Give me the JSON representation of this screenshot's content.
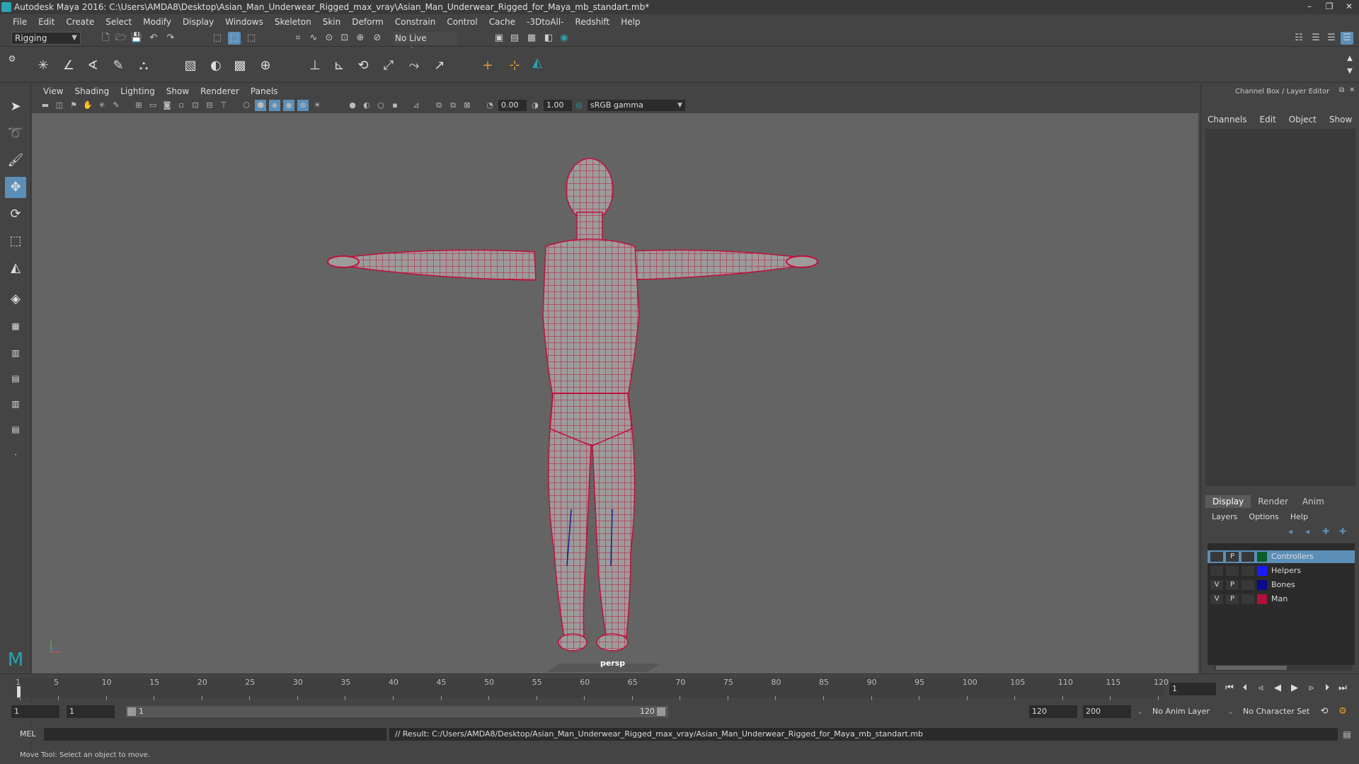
{
  "window": {
    "title": "Autodesk Maya 2016: C:\\Users\\AMDA8\\Desktop\\Asian_Man_Underwear_Rigged_max_vray\\Asian_Man_Underwear_Rigged_for_Maya_mb_standart.mb*"
  },
  "menubar": [
    "File",
    "Edit",
    "Create",
    "Select",
    "Modify",
    "Display",
    "Windows",
    "Skeleton",
    "Skin",
    "Deform",
    "Constrain",
    "Control",
    "Cache",
    "-3DtoAll-",
    "Redshift",
    "Help"
  ],
  "status": {
    "mode": "Rigging",
    "live_surface": "No Live Surface"
  },
  "panel": {
    "menu": [
      "View",
      "Shading",
      "Lighting",
      "Show",
      "Renderer",
      "Panels"
    ],
    "near_value": "0.00",
    "far_value": "1.00",
    "color_space": "sRGB gamma",
    "camera_label": "persp"
  },
  "channel_box": {
    "title": "Channel Box / Layer Editor",
    "menu": [
      "Channels",
      "Edit",
      "Object",
      "Show"
    ]
  },
  "layer_editor": {
    "tabs": [
      "Display",
      "Render",
      "Anim"
    ],
    "selected_tab": "Display",
    "menu": [
      "Layers",
      "Options",
      "Help"
    ],
    "layers": [
      {
        "name": "Controllers",
        "v": "",
        "p": "P",
        "color": "#0b5e2a",
        "selected": true
      },
      {
        "name": "Helpers",
        "v": "",
        "p": "",
        "color": "#1a1aff",
        "selected": false
      },
      {
        "name": "Bones",
        "v": "V",
        "p": "P",
        "color": "#0a0a8a",
        "selected": false
      },
      {
        "name": "Man",
        "v": "V",
        "p": "P",
        "color": "#b0103a",
        "selected": false
      }
    ]
  },
  "timeline": {
    "tick_labels": [
      "1",
      "5",
      "10",
      "15",
      "20",
      "25",
      "30",
      "35",
      "40",
      "45",
      "50",
      "55",
      "60",
      "65",
      "70",
      "75",
      "80",
      "85",
      "90",
      "95",
      "100",
      "105",
      "110",
      "115",
      "120"
    ],
    "current_frame": "1"
  },
  "range": {
    "start": "1",
    "playback_start": "1",
    "slider_start": "1",
    "slider_end": "120",
    "playback_end": "120",
    "end": "200",
    "anim_layer": "No Anim Layer",
    "character_set": "No Character Set"
  },
  "command": {
    "language": "MEL",
    "result": "// Result: C:/Users/AMDA8/Desktop/Asian_Man_Underwear_Rigged_max_vray/Asian_Man_Underwear_Rigged_for_Maya_mb_standart.mb"
  },
  "help_line": "Move Tool: Select an object to move.",
  "colors": {
    "accent": "#5c8fb8",
    "mesh_wire": "#c0103a",
    "viewport_bg": "#646464",
    "skin": "#9c9c9c"
  }
}
